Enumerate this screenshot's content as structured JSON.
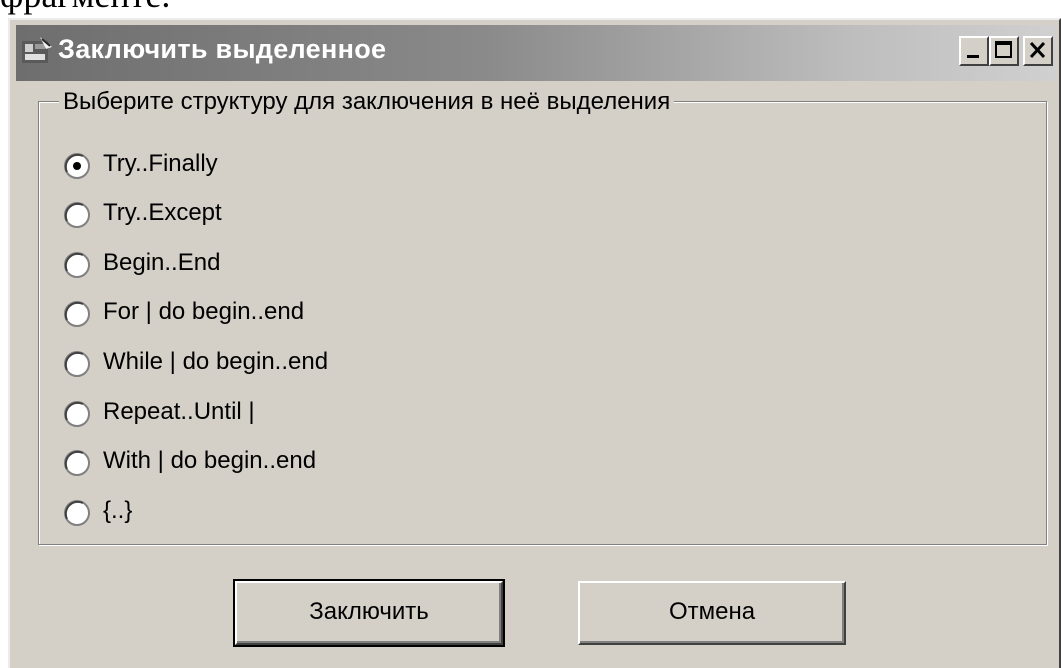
{
  "page_text_top": "фрагменте.",
  "window": {
    "title": "Заключить выделенное",
    "buttons": {
      "minimize": "minimize",
      "maximize": "maximize",
      "close": "close"
    }
  },
  "group": {
    "legend": "Выберите структуру для заключения в неё выделения",
    "options": [
      {
        "label": "Try..Finally",
        "selected": true
      },
      {
        "label": "Try..Except",
        "selected": false
      },
      {
        "label": "Begin..End",
        "selected": false
      },
      {
        "label": "For | do begin..end",
        "selected": false
      },
      {
        "label": "While | do begin..end",
        "selected": false
      },
      {
        "label": "Repeat..Until |",
        "selected": false
      },
      {
        "label": "With | do begin..end",
        "selected": false
      },
      {
        "label": "{..}",
        "selected": false
      }
    ]
  },
  "actions": {
    "ok_label": "Заключить",
    "cancel_label": "Отмена"
  },
  "colors": {
    "window_bg": "#d4d0c8",
    "title_text": "#ffffff"
  }
}
